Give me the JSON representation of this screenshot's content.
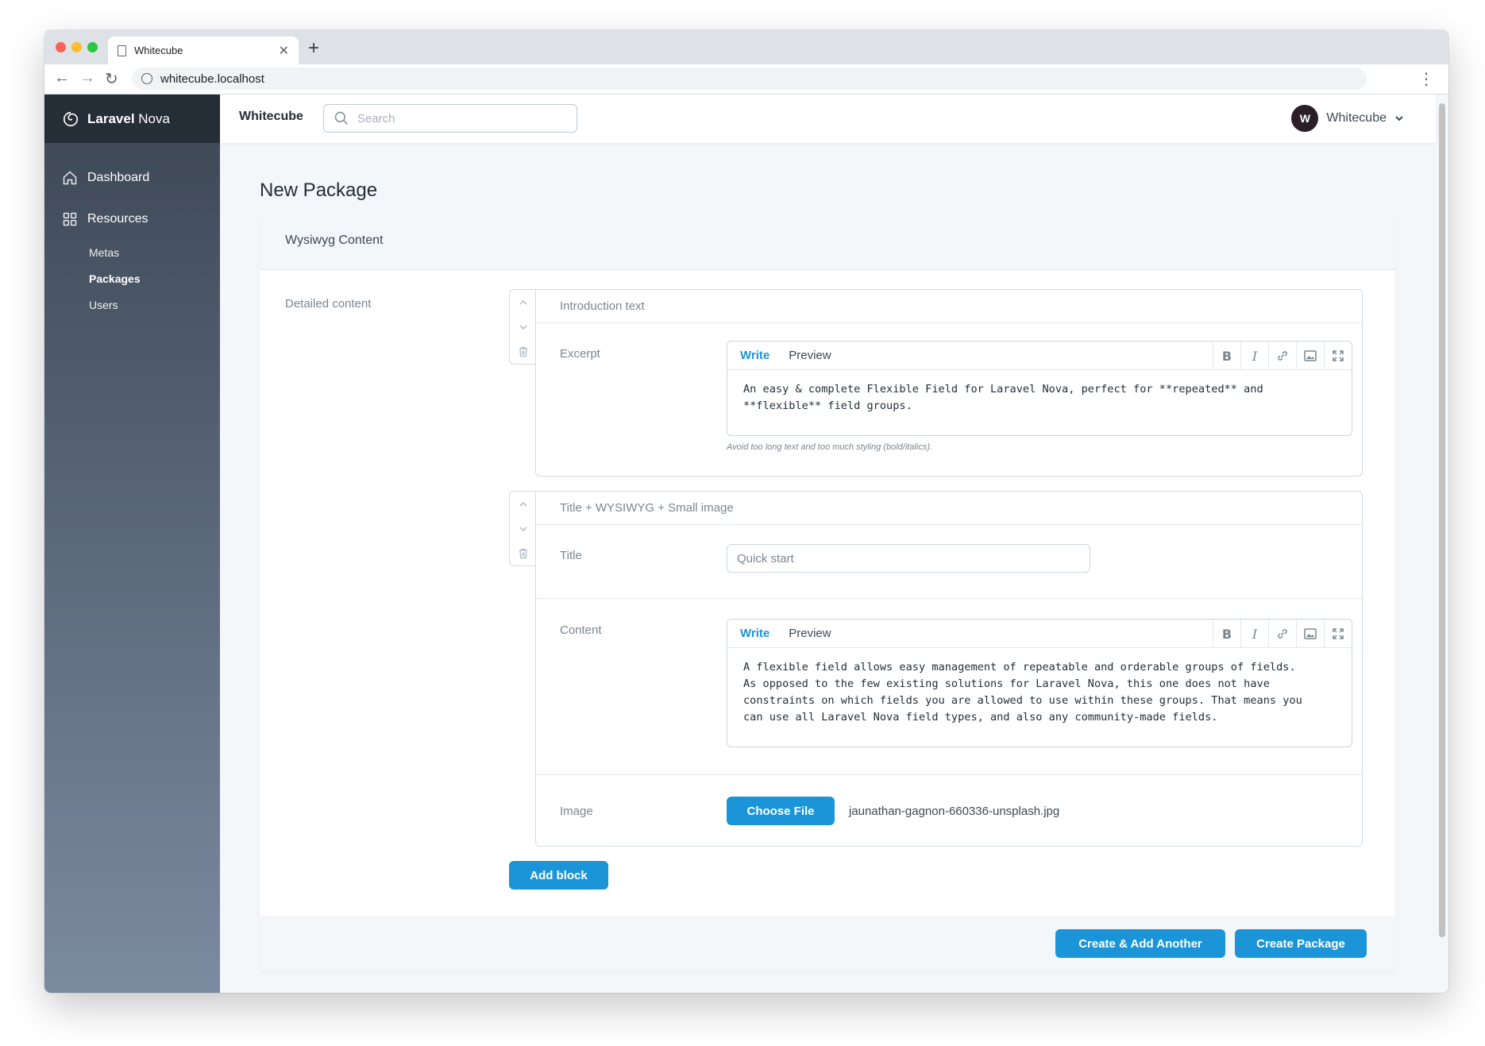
{
  "browser": {
    "tab_title": "Whitecube",
    "url": "whitecube.localhost"
  },
  "sidebar": {
    "brand_bold": "Laravel",
    "brand_rest": " Nova",
    "dashboard": "Dashboard",
    "resources": "Resources",
    "sub_items": [
      "Metas",
      "Packages",
      "Users"
    ]
  },
  "topbar": {
    "title": "Whitecube",
    "search_placeholder": "Search",
    "user_name": "Whitecube",
    "avatar_initial": "W"
  },
  "page": {
    "title": "New Package",
    "panel_title": "Wysiwyg Content",
    "field_label": "Detailed content"
  },
  "block1": {
    "header": "Introduction text",
    "excerpt_label": "Excerpt",
    "write_tab": "Write",
    "preview_tab": "Preview",
    "excerpt_text": "An easy & complete Flexible Field for Laravel Nova, perfect for **repeated** and\n**flexible** field groups.",
    "help": "Avoid too long text and too much styling (bold/italics)."
  },
  "block2": {
    "header": "Title + WYSIWYG + Small image",
    "title_label": "Title",
    "title_value": "Quick start",
    "content_label": "Content",
    "write_tab": "Write",
    "preview_tab": "Preview",
    "content_text": "A flexible field allows easy management of repeatable and orderable groups of fields.\nAs opposed to the few existing solutions for Laravel Nova, this one does not have\nconstraints on which fields you are allowed to use within these groups. That means you\ncan use all Laravel Nova field types, and also any community-made fields.",
    "image_label": "Image",
    "choose_file": "Choose File",
    "file_name": "jaunathan-gagnon-660336-unsplash.jpg"
  },
  "actions": {
    "add_block": "Add block",
    "create_add_another": "Create & Add Another",
    "create": "Create Package"
  },
  "colors": {
    "primary": "#1b94d8",
    "sidebar_top": "#3c4655",
    "sidebar_bottom": "#7b8ba0",
    "brand_bg": "#252d37"
  }
}
